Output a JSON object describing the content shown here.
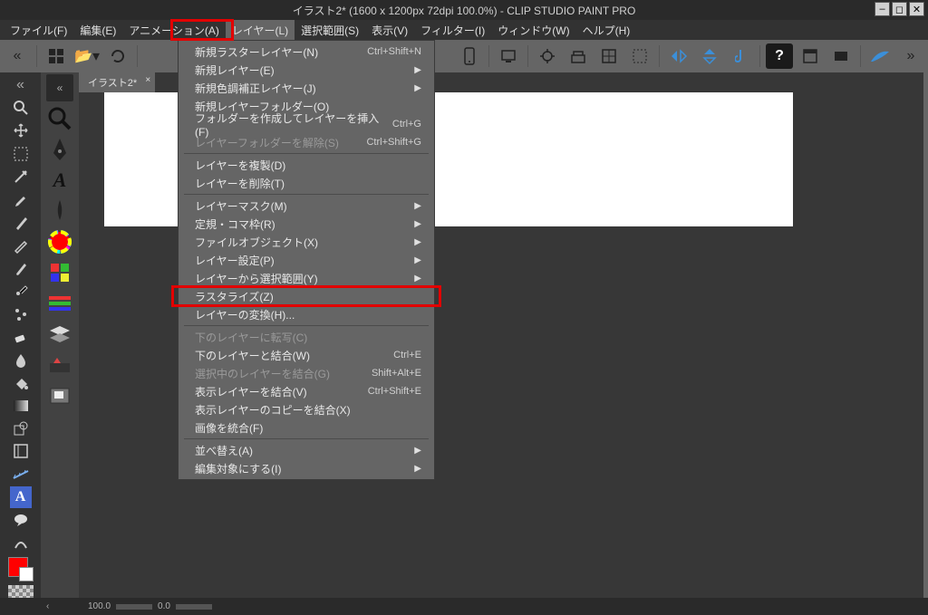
{
  "window": {
    "title": "イラスト2* (1600 x 1200px 72dpi 100.0%)   -  CLIP STUDIO PAINT PRO"
  },
  "menus": {
    "file": "ファイル(F)",
    "edit": "編集(E)",
    "animation": "アニメーション(A)",
    "layer": "レイヤー(L)",
    "select": "選択範囲(S)",
    "view": "表示(V)",
    "filter": "フィルター(I)",
    "window": "ウィンドウ(W)",
    "help": "ヘルプ(H)"
  },
  "doc_tab": {
    "label": "イラスト2*"
  },
  "bottom": {
    "zoom": "100.0",
    "angle": "0.0"
  },
  "dropdown": [
    {
      "type": "item",
      "label": "新規ラスターレイヤー(N)",
      "shortcut": "Ctrl+Shift+N",
      "enabled": true
    },
    {
      "type": "item",
      "label": "新規レイヤー(E)",
      "sub": true,
      "enabled": true
    },
    {
      "type": "item",
      "label": "新規色調補正レイヤー(J)",
      "sub": true,
      "enabled": true
    },
    {
      "type": "item",
      "label": "新規レイヤーフォルダー(O)",
      "enabled": true
    },
    {
      "type": "item",
      "label": "フォルダーを作成してレイヤーを挿入(F)",
      "shortcut": "Ctrl+G",
      "enabled": true
    },
    {
      "type": "item",
      "label": "レイヤーフォルダーを解除(S)",
      "shortcut": "Ctrl+Shift+G",
      "enabled": false
    },
    {
      "type": "sep"
    },
    {
      "type": "item",
      "label": "レイヤーを複製(D)",
      "enabled": true
    },
    {
      "type": "item",
      "label": "レイヤーを削除(T)",
      "enabled": true
    },
    {
      "type": "sep"
    },
    {
      "type": "item",
      "label": "レイヤーマスク(M)",
      "sub": true,
      "enabled": true
    },
    {
      "type": "item",
      "label": "定規・コマ枠(R)",
      "sub": true,
      "enabled": true
    },
    {
      "type": "item",
      "label": "ファイルオブジェクト(X)",
      "sub": true,
      "enabled": true
    },
    {
      "type": "item",
      "label": "レイヤー設定(P)",
      "sub": true,
      "enabled": true
    },
    {
      "type": "item",
      "label": "レイヤーから選択範囲(Y)",
      "sub": true,
      "enabled": true
    },
    {
      "type": "item",
      "label": "ラスタライズ(Z)",
      "enabled": true,
      "highlight": true
    },
    {
      "type": "item",
      "label": "レイヤーの変換(H)...",
      "enabled": true
    },
    {
      "type": "sep"
    },
    {
      "type": "item",
      "label": "下のレイヤーに転写(C)",
      "enabled": false
    },
    {
      "type": "item",
      "label": "下のレイヤーと結合(W)",
      "shortcut": "Ctrl+E",
      "enabled": true
    },
    {
      "type": "item",
      "label": "選択中のレイヤーを結合(G)",
      "shortcut": "Shift+Alt+E",
      "enabled": false
    },
    {
      "type": "item",
      "label": "表示レイヤーを結合(V)",
      "shortcut": "Ctrl+Shift+E",
      "enabled": true
    },
    {
      "type": "item",
      "label": "表示レイヤーのコピーを結合(X)",
      "enabled": true
    },
    {
      "type": "item",
      "label": "画像を統合(F)",
      "enabled": true
    },
    {
      "type": "sep"
    },
    {
      "type": "item",
      "label": "並べ替え(A)",
      "sub": true,
      "enabled": true
    },
    {
      "type": "item",
      "label": "編集対象にする(I)",
      "sub": true,
      "enabled": true
    }
  ]
}
